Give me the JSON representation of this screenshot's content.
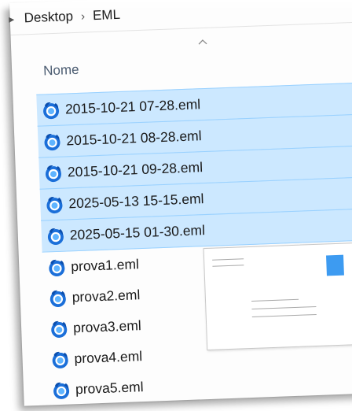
{
  "breadcrumb": {
    "items": [
      "Desktop",
      "EML"
    ]
  },
  "column": {
    "name_label": "Nome",
    "sort_icon": "chevron-up-icon"
  },
  "files": [
    {
      "name": "2015-10-21 07-28.eml",
      "selected": true
    },
    {
      "name": "2015-10-21 08-28.eml",
      "selected": true
    },
    {
      "name": "2015-10-21 09-28.eml",
      "selected": true
    },
    {
      "name": "2025-05-13 15-15.eml",
      "selected": true
    },
    {
      "name": "2025-05-15 01-30.eml",
      "selected": true
    },
    {
      "name": "prova1.eml",
      "selected": false
    },
    {
      "name": "prova2.eml",
      "selected": false
    },
    {
      "name": "prova3.eml",
      "selected": false
    },
    {
      "name": "prova4.eml",
      "selected": false
    },
    {
      "name": "prova5.eml",
      "selected": false
    }
  ],
  "icons": {
    "file": "thunderbird-eml-icon",
    "preview": "email-preview-thumbnail"
  },
  "colors": {
    "selection": "#cce8ff",
    "selection_border": "#99d1ff",
    "stamp": "#3d9bf1",
    "header_text": "#4a5b70"
  }
}
